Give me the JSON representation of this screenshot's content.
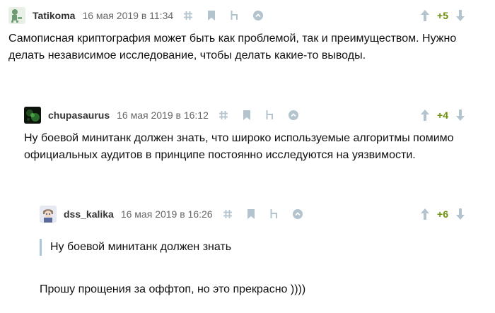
{
  "comments": [
    {
      "user": "Tatikoma",
      "date": "16 мая 2019 в 11:34",
      "score": "+5",
      "text": "Самописная криптография может быть как проблемой, так и преимуществом. Нужно делать независимое исследование, чтобы делать какие-то выводы."
    },
    {
      "user": "chupasaurus",
      "date": "16 мая 2019 в 16:12",
      "score": "+4",
      "text": "Ну боевой минитанк должен знать, что широко используемые алгоритмы помимо официальных аудитов в принципе постоянно исследуются на уязвимости."
    },
    {
      "user": "dss_kalika",
      "date": "16 мая 2019 в 16:26",
      "score": "+6",
      "quote": "Ну боевой минитанк должен знать",
      "text": "Прошу прощения за оффтоп, но это прекрасно ))))"
    }
  ],
  "icons": [
    "hash-icon",
    "bookmark-icon",
    "parent-icon",
    "collapse-icon",
    "vote-up-icon",
    "vote-down-icon"
  ],
  "colors": {
    "score": "#6c9007",
    "icon": "#b3c4cf",
    "quote_bar": "#a8c7d8"
  }
}
